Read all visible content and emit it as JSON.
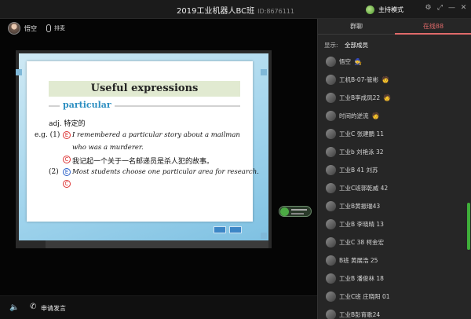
{
  "window": {
    "title": "2019工业机器人BC班",
    "room_id": "ID:8676111",
    "host_mode": "主持模式",
    "icons": [
      "settings-icon",
      "expand-icon",
      "minimize-icon",
      "close-icon"
    ]
  },
  "teacher": {
    "name": "悟空",
    "mic_label": "排麦"
  },
  "slide": {
    "title": "Useful expressions",
    "keyword": "particular",
    "pos": "adj. 特定的",
    "eg1_prefix": "e.g. (1)",
    "eg1_en_line1": "I remembered a particular story about a mailman",
    "eg1_en_line2": "who was a murderer.",
    "eg1_cn": "我记起一个关于一名邮递员是杀人犯的故事。",
    "eg2_prefix": "(2)",
    "eg2_en": "Most students choose one particular area for research.",
    "marker_e": "E",
    "marker_c": "C"
  },
  "bottom": {
    "apply_label": "申请发言"
  },
  "panel": {
    "tabs": [
      "群聊",
      "在线88"
    ],
    "active_tab": 1,
    "filter_label": "显示:",
    "filter_value": "全部成员",
    "members": [
      {
        "name": "悟空",
        "badge": "🧙"
      },
      {
        "name": "工机B-07-管彬",
        "badge": "🧑"
      },
      {
        "name": "工业B李成凤22",
        "badge": "🧑"
      },
      {
        "name": "时间的逆流",
        "badge": "🧑"
      },
      {
        "name": "工业C 张建鹏 11",
        "badge": ""
      },
      {
        "name": "工业b  刘艳泳  32",
        "badge": ""
      },
      {
        "name": "工业B 41 刘苏",
        "badge": ""
      },
      {
        "name": "工业C班郭乾威 42",
        "badge": ""
      },
      {
        "name": "工业B黄振瑞43",
        "badge": ""
      },
      {
        "name": "工业B  李晓晴 13",
        "badge": ""
      },
      {
        "name": "工业C 38 柯金宏",
        "badge": ""
      },
      {
        "name": "B班  黄展浩  25",
        "badge": ""
      },
      {
        "name": "工业B  潘俊林 18",
        "badge": ""
      },
      {
        "name": "工业C班 庄晓阳 01",
        "badge": ""
      },
      {
        "name": "工业B彭育歌24",
        "badge": ""
      }
    ]
  },
  "colors": {
    "accent": "#e06a6a",
    "keyword": "#2d8fc1",
    "title_bg": "#e1ead1",
    "scroll": "#3fae3a"
  }
}
